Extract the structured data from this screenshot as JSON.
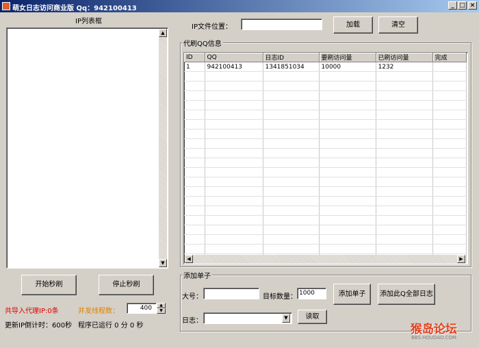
{
  "window": {
    "title": "萌女日志访问商业版 Qq：942100413",
    "min": "_",
    "max": "□",
    "close": "×"
  },
  "left": {
    "ip_list_label": "IP列表框",
    "start_button": "开始秒刷",
    "stop_button": "停止秒刷",
    "imported_proxy": "共导入代理IP:0条",
    "threads_label": "并发线程数：",
    "threads_value": "400",
    "countdown": "更新IP倒计时：600秒",
    "runtime": "程序已运行 0 分 0 秒"
  },
  "file": {
    "label": "IP文件位置：",
    "value": "",
    "load_button": "加载",
    "clear_button": "清空"
  },
  "orders": {
    "group_label": "代刷QQ信息",
    "columns": [
      "ID",
      "QQ",
      "日志ID",
      "要刷访问量",
      "已刷访问量",
      "完成"
    ],
    "rows": [
      [
        "1",
        "942100413",
        "1341851034",
        "10000",
        "1232",
        ""
      ]
    ]
  },
  "add_order": {
    "group_label": "添加单子",
    "big_label": "大号：",
    "big_value": "",
    "target_label": "目标数量：",
    "target_value": "1000",
    "add_button": "添加单子",
    "add_all_button": "添加此Q全部日志",
    "log_label": "日志：",
    "log_value": "",
    "read_button": "读取"
  },
  "watermark": {
    "brand": "猴岛论坛",
    "url": "BBS.HOUDAO.COM"
  }
}
